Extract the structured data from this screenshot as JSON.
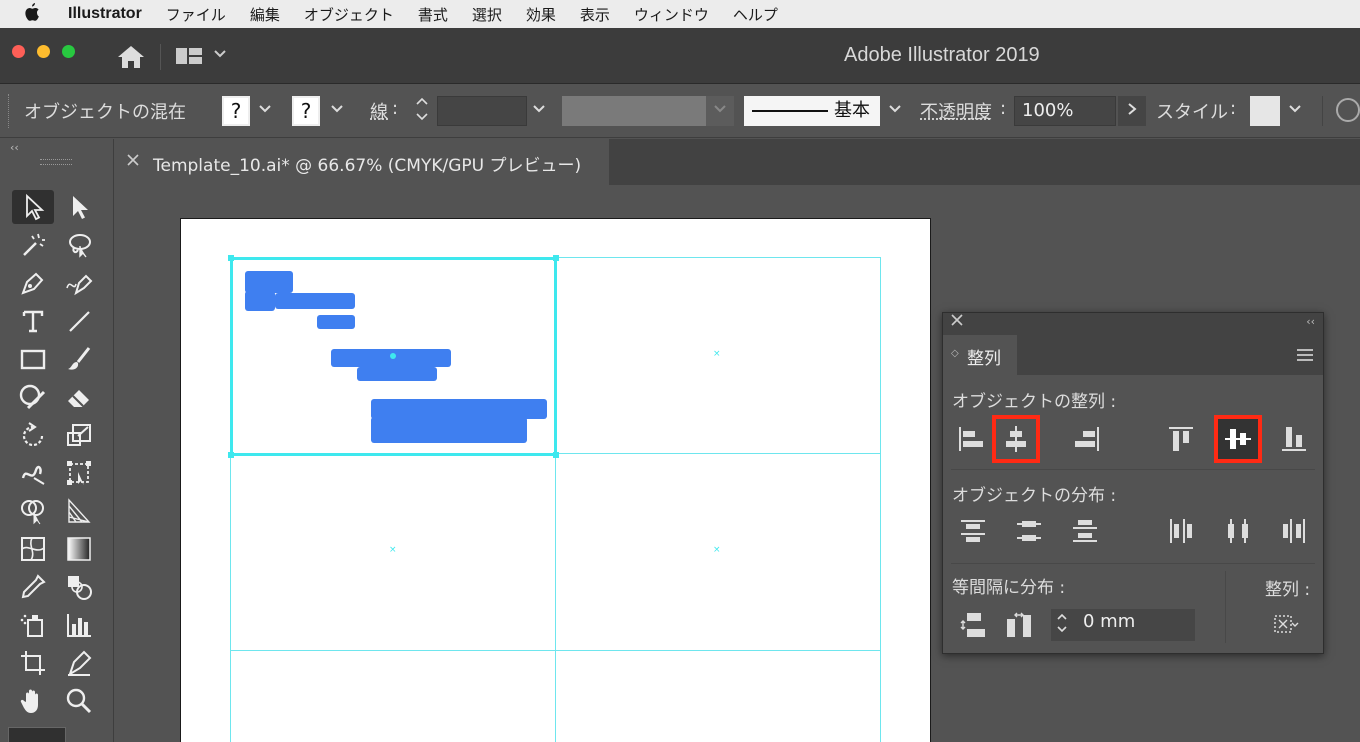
{
  "menubar": {
    "app_name": "Illustrator",
    "items": [
      "ファイル",
      "編集",
      "オブジェクト",
      "書式",
      "選択",
      "効果",
      "表示",
      "ウィンドウ",
      "ヘルプ"
    ]
  },
  "window": {
    "title": "Adobe Illustrator 2019"
  },
  "control_bar": {
    "mode_label": "オブジェクトの混在",
    "fill_unknown": "?",
    "stroke_unknown": "?",
    "stroke_label": "線",
    "colon": ":",
    "stroke_profile": "基本",
    "opacity_label": "不透明度",
    "opacity_value": "100%",
    "style_label": "スタイル"
  },
  "document": {
    "tab_name": "Template_10.ai* @ 66.67% (CMYK/GPU プレビュー)"
  },
  "align_panel": {
    "tab_label": "整列",
    "align_objects_label": "オブジェクトの整列 :",
    "distribute_objects_label": "オブジェクトの分布 :",
    "distribute_spacing_label": "等間隔に分布 :",
    "align_to_label": "整列 :",
    "spacing_value": "0 mm"
  },
  "colors": {
    "highlight": "#ff2a14",
    "guide": "#3ee8ee",
    "selection_content": "#3f7ff0"
  },
  "icons": [
    "apple-icon",
    "home-icon",
    "workspace-icon",
    "selection-tool-icon",
    "direct-selection-tool-icon",
    "magic-wand-icon",
    "lasso-icon",
    "pen-icon",
    "curvature-icon",
    "type-icon",
    "line-icon",
    "rectangle-icon",
    "paintbrush-icon",
    "shaper-icon",
    "eraser-icon",
    "rotate-icon",
    "scale-icon",
    "warp-icon",
    "free-transform-icon",
    "shape-builder-icon",
    "perspective-grid-icon",
    "mesh-icon",
    "gradient-icon",
    "eyedropper-icon",
    "blend-icon",
    "symbol-sprayer-icon",
    "graph-icon",
    "artboard-icon",
    "slice-icon",
    "hand-icon",
    "zoom-icon"
  ]
}
